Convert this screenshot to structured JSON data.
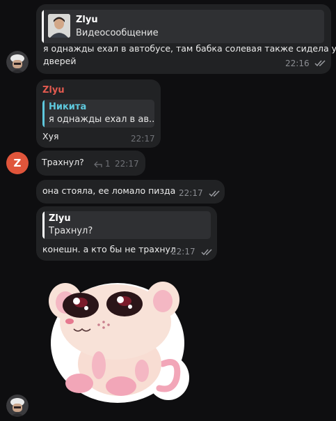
{
  "colors": {
    "red_name": "#e35a4f",
    "blue_name": "#5ec8dd",
    "bubble_bg": "#212224",
    "reply_bg": "#2f3033",
    "avatar_letter_bg": "#e0553b"
  },
  "messages": [
    {
      "reply": {
        "name": "Zlyu",
        "text": "Видеосообщение"
      },
      "text_line1": "я однажды ехал в автобусе, там бабка солевая также сидела у",
      "text_line2": "дверей",
      "time": "22:16"
    },
    {
      "sender": "Zlyu",
      "reply": {
        "name": "Никита",
        "text": "я однажды ехал в ав..."
      },
      "text": "Хуя",
      "time": "22:17"
    },
    {
      "avatar_letter": "Z",
      "text": "Трахнул?",
      "reply_count": "1",
      "time": "22:17"
    },
    {
      "text": "она стояла, ее ломало пизда",
      "time": "22:17"
    },
    {
      "reply": {
        "name": "Zlyu",
        "text": "Трахнул?"
      },
      "text": "конешн. а кто бы не трахнул",
      "time": "22:17"
    }
  ],
  "sticker": {
    "name": "rat-sticker"
  }
}
